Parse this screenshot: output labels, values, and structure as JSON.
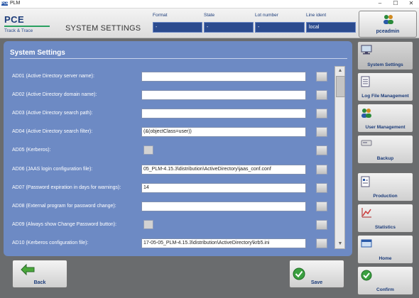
{
  "window": {
    "app_icon": "PCE",
    "title": "PLM",
    "minimize": "–",
    "maximize": "☐",
    "close": "✕"
  },
  "header": {
    "logo_main": "PCE",
    "logo_sub": "Track & Trace",
    "page_title": "SYSTEM SETTINGS",
    "fields": [
      {
        "label": "Format",
        "value": "-"
      },
      {
        "label": "State",
        "value": "-"
      },
      {
        "label": "Lot number",
        "value": "-"
      },
      {
        "label": "Line ident",
        "value": "local"
      }
    ],
    "user": {
      "name": "pceadmin",
      "icon": "users-icon"
    }
  },
  "panel": {
    "title": "System Settings",
    "rows": [
      {
        "label": "AD01 (Active Directory server name):",
        "type": "text",
        "value": ""
      },
      {
        "label": "AD02 (Active Directory domain name):",
        "type": "text",
        "value": ""
      },
      {
        "label": "AD03 (Active Directory search path):",
        "type": "text",
        "value": ""
      },
      {
        "label": "AD04 (Active Directory search filter):",
        "type": "text",
        "value": "(&(objectClass=user))"
      },
      {
        "label": "AD05 (Kerberos):",
        "type": "check",
        "value": ""
      },
      {
        "label": "AD06 (JAAS login configuration file):",
        "type": "text",
        "value": "05_PLM-4.15.3\\distribution\\ActiveDirectory\\jaas_conf.conf"
      },
      {
        "label": "AD07 (Password expiration in days for warnings):",
        "type": "text",
        "value": "14"
      },
      {
        "label": "AD08 (External program for password change):",
        "type": "text",
        "value": ""
      },
      {
        "label": "AD09 (Always show Change Password button):",
        "type": "check",
        "value": ""
      },
      {
        "label": "AD10 (Kerberos configuration file):",
        "type": "text",
        "value": "17-05-05_PLM-4.15.3\\distribution\\ActiveDirectory\\krb5.ini"
      }
    ]
  },
  "buttons": {
    "back": "Back",
    "save": "Save"
  },
  "sidebar": [
    {
      "label": "System Settings",
      "icon": "computer-icon"
    },
    {
      "label": "Log File Management",
      "icon": "log-file-icon"
    },
    {
      "label": "User Management",
      "icon": "users-icon"
    },
    {
      "label": "Backup",
      "icon": "backup-icon"
    },
    {
      "label": "Production",
      "icon": "production-icon"
    },
    {
      "label": "Statistics",
      "icon": "statistics-icon"
    },
    {
      "label": "Home",
      "icon": "home-icon"
    },
    {
      "label": "Confirm",
      "icon": "confirm-icon"
    }
  ],
  "colors": {
    "panel": "#6d8ac4",
    "header_field": "#2b4b8f",
    "accent_green": "#2aa060"
  }
}
